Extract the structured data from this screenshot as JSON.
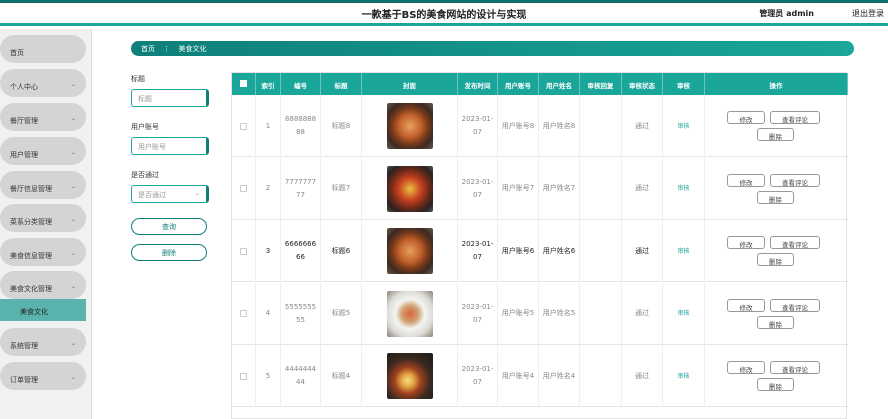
{
  "header": {
    "title": "一款基于BS的美食网站的设计与实现",
    "user": "管理员 admin",
    "logout": "退出登录"
  },
  "sidebar": {
    "items": [
      {
        "label": "首页",
        "chevron": false
      },
      {
        "label": "个人中心",
        "chevron": true
      },
      {
        "label": "餐厅管理",
        "chevron": true
      },
      {
        "label": "用户管理",
        "chevron": true
      },
      {
        "label": "餐厅信息管理",
        "chevron": true
      },
      {
        "label": "菜系分类管理",
        "chevron": true
      },
      {
        "label": "美食信息管理",
        "chevron": true
      },
      {
        "label": "美食文化管理",
        "chevron": true
      },
      {
        "label": "系统管理",
        "chevron": true
      },
      {
        "label": "订单管理",
        "chevron": true
      }
    ],
    "sub": "美食文化"
  },
  "breadcrumb": {
    "home": "首页",
    "sep": "⋮",
    "current": "美食文化"
  },
  "search": {
    "title_label": "标题",
    "title_placeholder": "标题",
    "account_label": "用户账号",
    "account_placeholder": "用户账号",
    "pass_label": "是否通过",
    "pass_placeholder": "是否通过",
    "query": "查询",
    "delete": "删除"
  },
  "table": {
    "headers": [
      "索引",
      "编号",
      "标题",
      "封面",
      "发布时间",
      "用户账号",
      "用户姓名",
      "审核回复",
      "审核状态",
      "审核",
      "操作"
    ],
    "rows": [
      {
        "idx": "1",
        "no": "888888888",
        "title": "标题8",
        "date": "2023-01-07",
        "account": "用户账号8",
        "name": "用户姓名8",
        "reply": "",
        "status": "通过",
        "audit": "审核",
        "dark": false,
        "img": "noodle"
      },
      {
        "idx": "2",
        "no": "777777777",
        "title": "标题7",
        "date": "2023-01-07",
        "account": "用户账号7",
        "name": "用户姓名7",
        "reply": "",
        "status": "通过",
        "audit": "审核",
        "dark": false,
        "img": "pot"
      },
      {
        "idx": "3",
        "no": "666666666",
        "title": "标题6",
        "date": "2023-01-07",
        "account": "用户账号6",
        "name": "用户姓名6",
        "reply": "",
        "status": "通过",
        "audit": "审核",
        "dark": true,
        "img": "noodle"
      },
      {
        "idx": "4",
        "no": "555555555",
        "title": "标题5",
        "date": "2023-01-07",
        "account": "用户账号5",
        "name": "用户姓名5",
        "reply": "",
        "status": "通过",
        "audit": "审核",
        "dark": false,
        "img": "plate"
      },
      {
        "idx": "5",
        "no": "444444444",
        "title": "标题4",
        "date": "2023-01-07",
        "account": "用户账号4",
        "name": "用户姓名4",
        "reply": "",
        "status": "通过",
        "audit": "审核",
        "dark": false,
        "img": "dark"
      }
    ],
    "actions": {
      "edit": "修改",
      "reviews": "查看评论",
      "delete": "删除"
    }
  },
  "colors": {
    "accent": "#1aa69a",
    "accent_dark": "#0e7f7a"
  }
}
